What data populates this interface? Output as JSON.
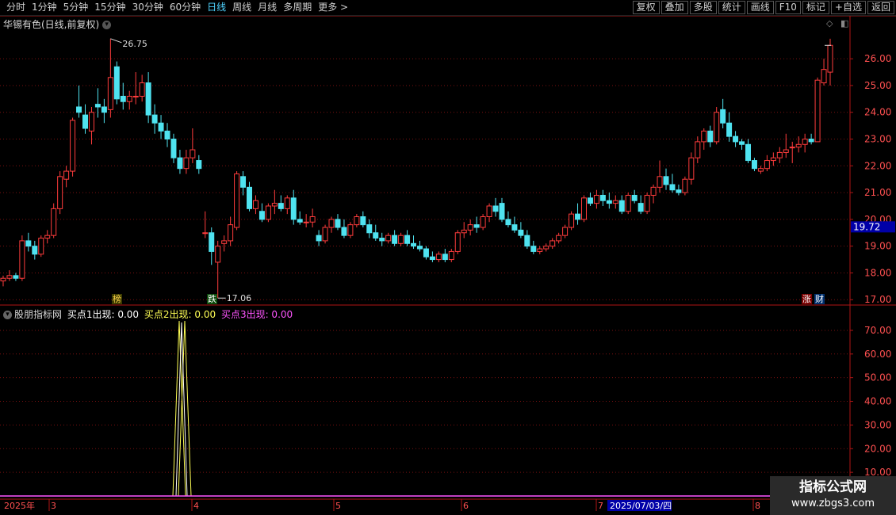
{
  "toolbar": {
    "tabs": [
      "分时",
      "1分钟",
      "5分钟",
      "15分钟",
      "30分钟",
      "60分钟",
      "日线",
      "周线",
      "月线",
      "多周期",
      "更多 >"
    ],
    "active_tab": "日线",
    "right_buttons": [
      "复权",
      "叠加",
      "多股",
      "统计",
      "画线",
      "F10",
      "标记",
      "+自选",
      "返回"
    ]
  },
  "stock": {
    "title": "华锡有色(日线,前复权)",
    "high_label": "26.75",
    "low_label": "17.06",
    "current_price": "19.72",
    "tag_bang": "榜",
    "tag_die": "跌",
    "tag_zhang": "涨",
    "tag_cai": "财"
  },
  "indicator": {
    "name": "股朋指标网",
    "line1": "买点1出现: 0.00",
    "line2": "买点2出现: 0.00",
    "line3": "买点3出现: 0.00"
  },
  "date_axis": {
    "year": "2025年",
    "months": [
      "3",
      "4",
      "5",
      "6",
      "7",
      "8"
    ],
    "cursor_date": "2025/07/03/四"
  },
  "watermark": {
    "line1": "指标公式网",
    "line2": "www.zbgs3.com"
  },
  "colors": {
    "up": "#ff3c3c",
    "down": "#4fe3f0",
    "grid": "#7a1010",
    "axis": "#b01515",
    "line1": "#ffffff",
    "line2": "#ffff55",
    "line3": "#ff55ff"
  },
  "chart_data": [
    {
      "type": "candlestick",
      "title": "华锡有色(日线,前复权)",
      "yticks": [
        17.0,
        18.0,
        19.0,
        20.0,
        21.0,
        22.0,
        23.0,
        24.0,
        25.0,
        26.0
      ],
      "ylim": [
        16.8,
        27.1
      ],
      "marked_high": 26.75,
      "marked_low": 17.06,
      "last_price": 19.72,
      "ohlc": [
        [
          17.7,
          17.9,
          17.5,
          17.8
        ],
        [
          17.8,
          18.1,
          17.7,
          17.9
        ],
        [
          17.9,
          18.0,
          17.7,
          17.8
        ],
        [
          17.8,
          19.4,
          17.7,
          19.2
        ],
        [
          19.2,
          19.5,
          18.8,
          19.0
        ],
        [
          19.0,
          19.2,
          18.5,
          18.7
        ],
        [
          18.7,
          19.4,
          18.6,
          19.3
        ],
        [
          19.3,
          19.6,
          19.1,
          19.4
        ],
        [
          19.4,
          20.6,
          19.3,
          20.4
        ],
        [
          20.4,
          21.8,
          20.2,
          21.6
        ],
        [
          21.5,
          22.0,
          21.2,
          21.8
        ],
        [
          21.8,
          23.8,
          21.6,
          23.7
        ],
        [
          24.2,
          25.0,
          23.8,
          24.0
        ],
        [
          23.9,
          24.3,
          23.2,
          23.4
        ],
        [
          23.3,
          24.2,
          22.8,
          24.0
        ],
        [
          24.3,
          24.9,
          23.8,
          24.2
        ],
        [
          24.2,
          24.5,
          23.6,
          24.0
        ],
        [
          24.1,
          26.75,
          23.8,
          25.3
        ],
        [
          25.7,
          25.9,
          24.3,
          24.5
        ],
        [
          24.6,
          25.1,
          24.1,
          24.4
        ],
        [
          24.4,
          24.8,
          24.1,
          24.6
        ],
        [
          24.6,
          25.5,
          24.3,
          24.6
        ],
        [
          24.6,
          25.4,
          24.4,
          25.1
        ],
        [
          25.1,
          25.5,
          23.6,
          23.9
        ],
        [
          23.9,
          24.3,
          23.2,
          23.6
        ],
        [
          23.6,
          23.9,
          23.0,
          23.3
        ],
        [
          23.3,
          23.6,
          22.7,
          23.0
        ],
        [
          23.0,
          23.2,
          22.1,
          22.3
        ],
        [
          22.3,
          22.6,
          21.7,
          21.9
        ],
        [
          21.9,
          22.6,
          21.7,
          22.3
        ],
        [
          22.3,
          23.4,
          22.1,
          22.6
        ],
        [
          22.2,
          22.4,
          21.7,
          21.9
        ],
        [
          19.5,
          20.3,
          19.3,
          19.5
        ],
        [
          19.5,
          19.7,
          18.3,
          18.8
        ],
        [
          18.4,
          19.2,
          17.06,
          19.0
        ],
        [
          19.1,
          19.4,
          18.8,
          19.2
        ],
        [
          19.2,
          20.1,
          19.0,
          19.8
        ],
        [
          19.7,
          21.8,
          19.6,
          21.7
        ],
        [
          21.6,
          21.8,
          20.9,
          21.2
        ],
        [
          21.2,
          21.4,
          20.3,
          20.4
        ],
        [
          20.4,
          20.9,
          20.2,
          20.7
        ],
        [
          20.3,
          20.6,
          19.9,
          20.0
        ],
        [
          20.0,
          20.6,
          19.9,
          20.5
        ],
        [
          20.5,
          21.1,
          20.2,
          20.6
        ],
        [
          20.6,
          20.9,
          20.3,
          20.4
        ],
        [
          20.4,
          20.9,
          20.2,
          20.8
        ],
        [
          20.8,
          21.1,
          19.8,
          20.0
        ],
        [
          20.0,
          20.3,
          19.8,
          19.9
        ],
        [
          19.9,
          20.2,
          19.7,
          19.9
        ],
        [
          19.9,
          20.4,
          19.7,
          20.1
        ],
        [
          19.4,
          19.6,
          19.0,
          19.2
        ],
        [
          19.2,
          19.8,
          19.1,
          19.7
        ],
        [
          19.7,
          20.1,
          19.5,
          20.0
        ],
        [
          20.0,
          20.2,
          19.6,
          19.7
        ],
        [
          19.7,
          20.0,
          19.3,
          19.4
        ],
        [
          19.4,
          19.9,
          19.3,
          19.8
        ],
        [
          19.8,
          20.2,
          19.7,
          20.1
        ],
        [
          20.1,
          20.3,
          19.7,
          19.8
        ],
        [
          19.8,
          20.0,
          19.3,
          19.5
        ],
        [
          19.5,
          19.8,
          19.2,
          19.3
        ],
        [
          19.3,
          19.5,
          19.0,
          19.2
        ],
        [
          19.2,
          19.5,
          19.1,
          19.4
        ],
        [
          19.4,
          19.6,
          19.0,
          19.1
        ],
        [
          19.1,
          19.5,
          19.0,
          19.4
        ],
        [
          19.4,
          19.6,
          19.0,
          19.1
        ],
        [
          19.1,
          19.4,
          18.9,
          19.0
        ],
        [
          19.0,
          19.2,
          18.8,
          18.9
        ],
        [
          18.9,
          19.0,
          18.5,
          18.6
        ],
        [
          18.6,
          18.8,
          18.4,
          18.5
        ],
        [
          18.5,
          18.8,
          18.4,
          18.7
        ],
        [
          18.7,
          18.9,
          18.4,
          18.5
        ],
        [
          18.5,
          18.9,
          18.4,
          18.8
        ],
        [
          18.8,
          19.6,
          18.7,
          19.5
        ],
        [
          19.5,
          19.9,
          19.3,
          19.6
        ],
        [
          19.6,
          20.0,
          19.4,
          19.8
        ],
        [
          19.8,
          20.1,
          19.5,
          19.7
        ],
        [
          19.7,
          20.2,
          19.6,
          20.1
        ],
        [
          20.1,
          20.6,
          19.9,
          20.5
        ],
        [
          20.5,
          20.8,
          20.1,
          20.3
        ],
        [
          20.6,
          20.8,
          19.9,
          20.0
        ],
        [
          20.0,
          20.3,
          19.7,
          19.8
        ],
        [
          19.8,
          20.1,
          19.5,
          19.6
        ],
        [
          19.6,
          19.9,
          19.3,
          19.4
        ],
        [
          19.4,
          19.6,
          18.9,
          19.0
        ],
        [
          19.0,
          19.2,
          18.7,
          18.8
        ],
        [
          18.8,
          19.0,
          18.7,
          18.9
        ],
        [
          18.9,
          19.1,
          18.8,
          19.0
        ],
        [
          19.0,
          19.3,
          18.9,
          19.2
        ],
        [
          19.2,
          19.5,
          19.1,
          19.4
        ],
        [
          19.4,
          19.8,
          19.3,
          19.7
        ],
        [
          19.7,
          20.3,
          19.6,
          20.2
        ],
        [
          20.2,
          20.6,
          19.8,
          20.0
        ],
        [
          20.0,
          20.9,
          19.9,
          20.8
        ],
        [
          20.8,
          21.0,
          20.5,
          20.6
        ],
        [
          20.6,
          21.1,
          20.4,
          20.9
        ],
        [
          20.9,
          21.1,
          20.5,
          20.7
        ],
        [
          20.7,
          21.0,
          20.4,
          20.6
        ],
        [
          20.6,
          20.9,
          20.4,
          20.7
        ],
        [
          20.7,
          20.9,
          20.2,
          20.3
        ],
        [
          20.3,
          21.0,
          20.2,
          20.9
        ],
        [
          20.9,
          21.1,
          20.6,
          20.7
        ],
        [
          20.6,
          20.9,
          20.2,
          20.3
        ],
        [
          20.3,
          21.0,
          20.2,
          20.9
        ],
        [
          20.9,
          21.3,
          20.6,
          21.2
        ],
        [
          21.2,
          22.2,
          21.0,
          21.6
        ],
        [
          21.6,
          21.9,
          21.1,
          21.3
        ],
        [
          21.3,
          21.7,
          21.0,
          21.1
        ],
        [
          21.1,
          21.3,
          20.9,
          21.0
        ],
        [
          21.0,
          21.6,
          20.9,
          21.5
        ],
        [
          21.5,
          22.5,
          21.3,
          22.3
        ],
        [
          22.3,
          23.1,
          22.1,
          22.9
        ],
        [
          22.9,
          23.4,
          22.6,
          23.3
        ],
        [
          23.3,
          23.5,
          22.7,
          22.9
        ],
        [
          22.9,
          24.2,
          22.8,
          24.0
        ],
        [
          24.1,
          24.5,
          23.4,
          23.6
        ],
        [
          23.6,
          24.0,
          22.9,
          23.1
        ],
        [
          23.1,
          23.3,
          22.7,
          22.9
        ],
        [
          22.9,
          23.0,
          22.6,
          22.8
        ],
        [
          22.8,
          23.0,
          22.1,
          22.2
        ],
        [
          22.2,
          22.3,
          21.8,
          21.9
        ],
        [
          21.8,
          22.0,
          21.7,
          21.9
        ],
        [
          21.9,
          22.4,
          21.8,
          22.2
        ],
        [
          22.2,
          22.5,
          22.0,
          22.3
        ],
        [
          22.3,
          22.7,
          22.1,
          22.5
        ],
        [
          22.5,
          23.2,
          22.3,
          22.6
        ],
        [
          22.7,
          22.9,
          22.1,
          22.7
        ],
        [
          22.7,
          23.1,
          22.5,
          22.8
        ],
        [
          22.8,
          23.2,
          22.5,
          23.0
        ],
        [
          23.0,
          23.2,
          22.8,
          22.9
        ],
        [
          22.9,
          25.3,
          22.9,
          25.2
        ],
        [
          25.1,
          26.0,
          25.0,
          25.6
        ],
        [
          25.5,
          26.75,
          25.0,
          26.5
        ]
      ]
    },
    {
      "type": "line",
      "series": [
        {
          "name": "买点1出现",
          "values": [
            0,
            0,
            0,
            0,
            0,
            0,
            0,
            0,
            0,
            0,
            0,
            0,
            0,
            0,
            0,
            0,
            0,
            0,
            0,
            0,
            0,
            0,
            0,
            0,
            0,
            0,
            0,
            0,
            0,
            0,
            0,
            0,
            0,
            0,
            0,
            0
          ]
        },
        {
          "name": "买点2出现",
          "values": []
        },
        {
          "name": "买点3出现",
          "values": []
        }
      ],
      "yticks": [
        10.0,
        20.0,
        30.0,
        40.0,
        50.0,
        60.0,
        70.0
      ],
      "ylim": [
        0,
        74
      ],
      "spike_index_1": 34,
      "spike_index_2": 35,
      "spike_value": 75
    }
  ]
}
